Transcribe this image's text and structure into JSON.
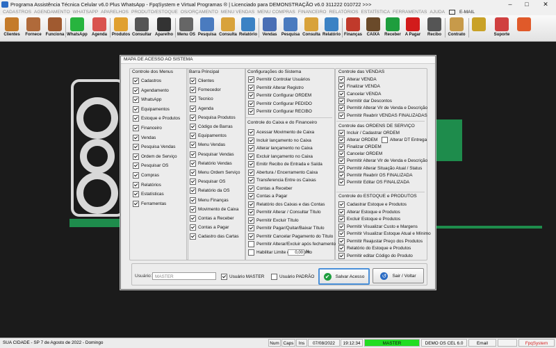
{
  "window": {
    "title": "Programa Assistência Técnica Celular v6.0 Plus WhatsApp - FpqSystem e Virtual Programas ® | Licenciado para  DEMONSTRAÇÃO v6.0 311222 010722 >>>"
  },
  "menubar": [
    "CADASTROS",
    "AGENDAMENTO",
    "WHATSAPP",
    "APARELHOS",
    "PRODUTO/ESTOQUE",
    "OS/ORÇAMENTO",
    "MENU VENDAS",
    "MENU COMPRAS",
    "FINANCEIRO",
    "RELATÓRIOS",
    "ESTATÍSTICA",
    "FERRAMENTAS",
    "AJUDA"
  ],
  "menubar_email": "E-MAIL",
  "toolbar": [
    {
      "label": "Clientes",
      "icon": "clients-icon",
      "color": "#c47b2a"
    },
    {
      "label": "Fornece",
      "icon": "supplier-icon",
      "color": "#b06a3a"
    },
    {
      "label": "Funciona",
      "icon": "employee-icon",
      "color": "#a05a30"
    },
    {
      "label": "WhatsApp",
      "icon": "whatsapp-icon",
      "color": "#27b43e"
    },
    {
      "label": "Agenda",
      "icon": "calendar-icon",
      "color": "#d9534f"
    },
    {
      "label": "Produtos",
      "icon": "products-icon",
      "color": "#e0a030"
    },
    {
      "label": "Consultar",
      "icon": "search-products-icon",
      "color": "#555555"
    },
    {
      "label": "Aparelho",
      "icon": "device-icon",
      "color": "#333333"
    },
    {
      "label": "Menu OS",
      "icon": "service-order-icon",
      "color": "#666666"
    },
    {
      "label": "Pesquisa",
      "icon": "search-os-icon",
      "color": "#4a7bbf"
    },
    {
      "label": "Consulta",
      "icon": "consult-os-icon",
      "color": "#d8a23a"
    },
    {
      "label": "Relatório",
      "icon": "report-os-icon",
      "color": "#3b82c4"
    },
    {
      "label": "Vendas",
      "icon": "sales-icon",
      "color": "#4a6fb5"
    },
    {
      "label": "Pesquisa",
      "icon": "search-sales-icon",
      "color": "#4a7bbf"
    },
    {
      "label": "Consulta",
      "icon": "consult-sales-icon",
      "color": "#d8a23a"
    },
    {
      "label": "Relatório",
      "icon": "report-sales-icon",
      "color": "#3b82c4"
    },
    {
      "label": "Finanças",
      "icon": "finance-icon",
      "color": "#c03a2b"
    },
    {
      "label": "CAIXA",
      "icon": "cashier-icon",
      "color": "#6a4a2a"
    },
    {
      "label": "Receber",
      "icon": "receive-icon",
      "color": "#1e9e3e"
    },
    {
      "label": "A Pagar",
      "icon": "pay-icon",
      "color": "#d21b1b"
    },
    {
      "label": "Recibo",
      "icon": "receipt-icon",
      "color": "#555555"
    },
    {
      "label": "Contrato",
      "icon": "contract-icon",
      "color": "#c79a4a"
    },
    {
      "label": "",
      "icon": "money-icon",
      "color": "#c9a227"
    },
    {
      "label": "Suporte",
      "icon": "support-icon",
      "color": "#d04040"
    },
    {
      "label": "",
      "icon": "exit-icon",
      "color": "#e05a2a"
    }
  ],
  "dialog": {
    "title": "MAPA DE ACESSO AO SISTEMA",
    "groups": {
      "menus": {
        "title": "Controle dos Menus",
        "items": [
          {
            "label": "Cadastros",
            "checked": true
          },
          {
            "label": "Agendamento",
            "checked": true
          },
          {
            "label": "WhatsApp",
            "checked": true
          },
          {
            "label": "Equipamentos",
            "checked": true
          },
          {
            "label": "Estoque e Produtos",
            "checked": true
          },
          {
            "label": "Financeiro",
            "checked": true
          },
          {
            "label": "Vendas",
            "checked": true
          },
          {
            "label": "Pesquisa Vendas",
            "checked": true
          },
          {
            "label": "Ordem de Serviço",
            "checked": true
          },
          {
            "label": "Pesquisar OS",
            "checked": true
          },
          {
            "label": "Compras",
            "checked": true
          },
          {
            "label": "Relatórios",
            "checked": true
          },
          {
            "label": "Estatísticas",
            "checked": true
          },
          {
            "label": "Ferramentas",
            "checked": true
          }
        ]
      },
      "barra": {
        "title": "Barra Principal",
        "items": [
          {
            "label": "Clientes",
            "checked": true
          },
          {
            "label": "Fornecedor",
            "checked": true
          },
          {
            "label": "Tecnico",
            "checked": true
          },
          {
            "label": "Agenda",
            "checked": true
          },
          {
            "label": "Pesquisa Produtos",
            "checked": true
          },
          {
            "label": "Código de Barras",
            "checked": true
          },
          {
            "label": "Equipamentos",
            "checked": true
          },
          {
            "label": "Menu Vendas",
            "checked": true
          },
          {
            "label": "Pesquisar Vendas",
            "checked": true
          },
          {
            "label": "Relatório Vendas",
            "checked": true
          },
          {
            "label": "Menu Ordem Serviço",
            "checked": true
          },
          {
            "label": "Pesquisar OS",
            "checked": true
          },
          {
            "label": "Relatório da OS",
            "checked": true
          },
          {
            "label": "Menu Finanças",
            "checked": true
          },
          {
            "label": "Movimento de Caixa",
            "checked": true
          },
          {
            "label": "Contas a Receber",
            "checked": true
          },
          {
            "label": "Contas a Pagar",
            "checked": true
          },
          {
            "label": "Cadastro das Cartas",
            "checked": true
          }
        ]
      },
      "config": {
        "title": "Configurações do Sistema",
        "items": [
          {
            "label": "Permitir Controlar Usuários",
            "checked": true
          },
          {
            "label": "Permitir Alterar Registro",
            "checked": true
          },
          {
            "label": "Permitir Configurar ORDEM",
            "checked": true
          },
          {
            "label": "Permitir Configurar PEDIDO",
            "checked": true
          },
          {
            "label": "Permitir Configurar RECIBO",
            "checked": true
          }
        ]
      },
      "caixa": {
        "title": "Controle do Caixa e do Financeiro",
        "items": [
          {
            "label": "Acessar Movimento de Caixa",
            "checked": true
          },
          {
            "label": "Incluir lançamento no Caixa",
            "checked": true
          },
          {
            "label": "Alterar lançamento no Caixa",
            "checked": true
          },
          {
            "label": "Excluir lançamento no Caixa",
            "checked": true
          },
          {
            "label": "Emitir Recibo de Entrada e Saída",
            "checked": true
          },
          {
            "label": "Abertura / Encerramento Caixa",
            "checked": true
          },
          {
            "label": "Transferencia Entre os Caixas",
            "checked": true
          },
          {
            "label": "Contas a Receber",
            "checked": true
          },
          {
            "label": "Contas a Pagar",
            "checked": true
          },
          {
            "label": "Relatório dos Caixas e das Contas",
            "checked": true
          },
          {
            "label": "Permitir Alterar / Consultar Título",
            "checked": true
          },
          {
            "label": "Permitir Excluir Título",
            "checked": true
          },
          {
            "label": "Permitir Pagar/Quitar/Baixar Título",
            "checked": true
          },
          {
            "label": "Permitir Cancelar Pagamento do Título",
            "checked": true
          },
          {
            "label": "Permitir Alterar/Excluir após fechamento",
            "checked": false
          },
          {
            "label": "Habilitar Limite de Desconto",
            "checked": false
          }
        ],
        "discount_value": "0,00",
        "discount_unit": "%"
      },
      "vendas": {
        "title": "Controle das VENDAS",
        "items": [
          {
            "label": "Alterar VENDA",
            "checked": true
          },
          {
            "label": "Finalizar VENDA",
            "checked": true
          },
          {
            "label": "Cancelar VENDA",
            "checked": true
          },
          {
            "label": "Permitir dar Descontos",
            "checked": true
          },
          {
            "label": "Permitir Alterar Vlr de Venda e Descrição",
            "checked": true
          },
          {
            "label": "Permitir Reabrir VENDAS FINALIZADAS",
            "checked": true
          }
        ]
      },
      "os": {
        "title": "Controle das ORDENS DE SERVIÇO",
        "items": [
          {
            "label": "Incluir / Cadastrar ORDEM",
            "checked": true
          },
          {
            "label": "Alterar ORDEM",
            "checked": true
          },
          {
            "label": "Finalizar ORDEM",
            "checked": true
          },
          {
            "label": "Cancelar ORDEM",
            "checked": true
          },
          {
            "label": "Permitir Alterar Vlr de Venda e Descrição",
            "checked": true
          },
          {
            "label": "Permitir Alterar Situação Atual / Status",
            "checked": true
          },
          {
            "label": "Permitir Reabrir OS FINALIZADA",
            "checked": true
          },
          {
            "label": "Permitir Editar OS FINALIZADA",
            "checked": true
          }
        ],
        "extra": {
          "label": "Alterar DT Entrega",
          "checked": false
        }
      },
      "estoque": {
        "title": "Controle do ESTOQUE e PRODUTOS",
        "items": [
          {
            "label": "Cadastrar Estoque e Produtos",
            "checked": true
          },
          {
            "label": "Alterar Estoque e Produtos",
            "checked": true
          },
          {
            "label": "Excluir Estoque e Produtos",
            "checked": true
          },
          {
            "label": "Permitir Visualizar Custo e Margens",
            "checked": true
          },
          {
            "label": "Permitir Visualizar Estoque Atual e Mínimo",
            "checked": true
          },
          {
            "label": "Permitir Reajustar Preço dos Produtos",
            "checked": true
          },
          {
            "label": "Relatório do Estoque e Produtos",
            "checked": true
          },
          {
            "label": "Permitir editar Código do Produto",
            "checked": true
          }
        ]
      }
    },
    "user": {
      "label": "Usuário:",
      "value": "MASTER",
      "master_label": "Usuário MASTER",
      "master_checked": true,
      "padrao_label": "Usuário PADRÃO",
      "padrao_checked": false
    },
    "buttons": {
      "save": "Salvar Acesso",
      "exit": "Sair / Voltar"
    }
  },
  "statusbar": {
    "location": "SUA CIDADE - SP  7 de Agosto de 2022 - Domingo",
    "num": "Num",
    "caps": "Caps",
    "ins": "Ins",
    "date": "07/08/2022",
    "time": "19:12:34",
    "user": "MASTER",
    "demo": "DEMO OS CEL 6.0",
    "email": "Email",
    "brand": "FpqSystem"
  }
}
